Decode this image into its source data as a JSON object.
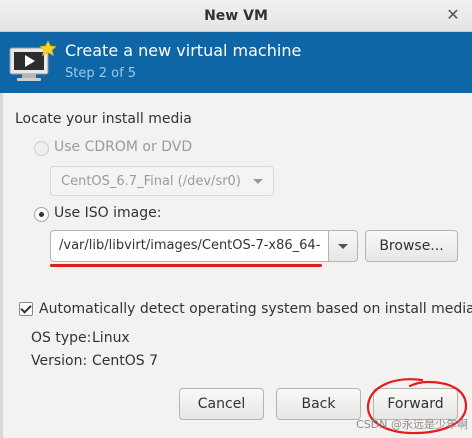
{
  "window": {
    "title": "New VM",
    "close_icon": "close-icon"
  },
  "banner": {
    "title": "Create a new virtual machine",
    "step": "Step 2 of 5",
    "icon": "virtual-machine-icon",
    "bg_color": "#0e66a6"
  },
  "media": {
    "heading": "Locate your install media",
    "cdrom_label": "Use CDROM or DVD",
    "cdrom_selected": false,
    "cdrom_enabled": false,
    "cdrom_value": "CentOS_6.7_Final (/dev/sr0)",
    "iso_label": "Use ISO image:",
    "iso_selected": true,
    "iso_path": "/var/lib/libvirt/images/CentOS-7-x86_64-",
    "browse_label": "Browse..."
  },
  "os": {
    "auto_detect_label": "Automatically detect operating system based on install media",
    "auto_detect_checked": true,
    "type_label": "OS type:",
    "type_value": "Linux",
    "version_label": "Version:",
    "version_value": "CentOS 7"
  },
  "footer": {
    "cancel_label": "Cancel",
    "back_label": "Back",
    "forward_label": "Forward"
  },
  "watermark": "CSDN @永远是少年啊",
  "annotation_color": "#e01e1e"
}
